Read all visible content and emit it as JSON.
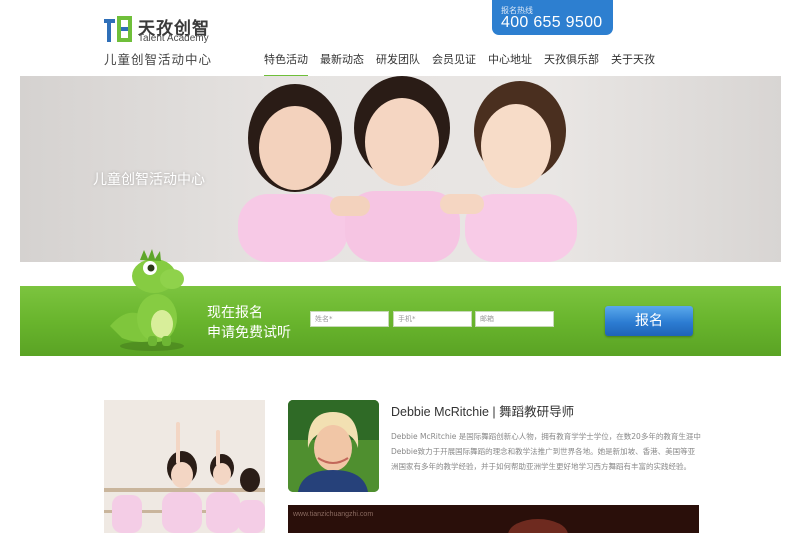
{
  "brand": {
    "name_cn": "天孜创智",
    "name_en": "Talent Academy",
    "subtitle": "儿童创智活动中心"
  },
  "hotline": {
    "label": "报名热线",
    "number": "400 655 9500"
  },
  "nav": {
    "items": [
      {
        "label": "特色活动",
        "active": true
      },
      {
        "label": "最新动态",
        "active": false
      },
      {
        "label": "研发团队",
        "active": false
      },
      {
        "label": "会员见证",
        "active": false
      },
      {
        "label": "中心地址",
        "active": false
      },
      {
        "label": "天孜俱乐部",
        "active": false
      },
      {
        "label": "关于天孜",
        "active": false
      }
    ],
    "active_color": "#6fbf3a"
  },
  "hero": {
    "title": "儿童创智活动中心"
  },
  "signup": {
    "line1": "现在报名",
    "line2": "申请免费试听",
    "fields": {
      "name_placeholder": "姓名*",
      "phone_placeholder": "手机*",
      "email_placeholder": "邮箱"
    },
    "button_label": "报名",
    "band_color": "#6cb82f",
    "button_color": "#2c7cd2"
  },
  "teacher": {
    "name": "Debbie McRitchie | 舞蹈教研导师",
    "bio": "Debbie McRitchie 是国际舞蹈创新心人物，拥有教育学学士学位，在数20多年的教育生涯中Debbie致力于开展国际舞蹈的理念和教学法推广到世界各地。她是新加坡、香港、美国等亚洲国家有多年的教学经验，并于如何帮助亚洲学生更好地学习西方舞蹈有丰富的实践经验。"
  },
  "video": {
    "watermark": "www.tianzichuangzhi.com"
  }
}
